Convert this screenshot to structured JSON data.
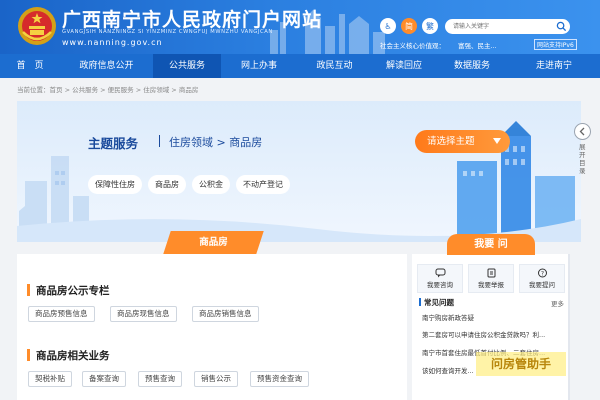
{
  "header": {
    "title": "广西南宁市人民政府门户网站",
    "subtitle": "GVANGJSIH NANZNINGZ SI YINZMINZ CWNGFUJ MWNZHU VANGJCAN",
    "url": "www.nanning.gov.cn",
    "btn_accessibility": "♿",
    "btn_simplified": "简",
    "btn_traditional": "繁",
    "search_placeholder": "请输入关键字",
    "link_values": "社会主义核心价值观：",
    "link_values2": "富强、民主...",
    "ipv6": "网站支持IPv6"
  },
  "nav": [
    "首　页",
    "政府信息公开",
    "公共服务",
    "网上办事",
    "政民互动",
    "解读回应",
    "数据服务",
    "走进南宁"
  ],
  "breadcrumb": "当前位置：首页 > 公共服务 > 便民服务 > 住房领域 > 商品房",
  "banner": {
    "title": "主题服务",
    "path": "住房领域 > 商品房",
    "select": "请选择主题",
    "tags": [
      "保障性住房",
      "商品房",
      "公积金",
      "不动产登记"
    ]
  },
  "tab_label": "商品房",
  "sections": {
    "s1_title": "商品房公示专栏",
    "s1_buttons": [
      "商品房预售信息",
      "商品房现售信息",
      "商品房销售信息"
    ],
    "s2_title": "商品房相关业务",
    "s2_buttons": [
      "契税补贴",
      "备案查询",
      "预售查询",
      "销售公示",
      "预售资金查询"
    ]
  },
  "sidebar": {
    "ask_title": "我要 问",
    "ask": [
      "我要咨询",
      "我要举报",
      "我要提问"
    ],
    "faq_title": "常见问题",
    "faq_more": "更多",
    "faq": [
      "南宁购房新政答疑",
      "第二套房可以申请住房公积金贷款吗？利...",
      "南宁市首套住房最低首付比例、二套住房...",
      "该如何查询开发..."
    ]
  },
  "float_label": "展开目录",
  "watermark": "问房管助手",
  "colors": {
    "primary_blue": "#1c6dd0",
    "accent_orange": "#ff8c2a",
    "header_blue": "#2b7fe0"
  }
}
